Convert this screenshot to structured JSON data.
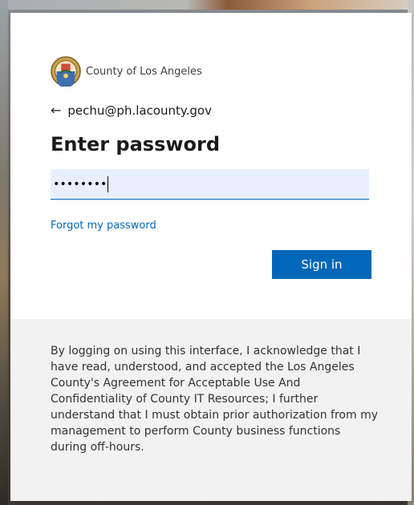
{
  "organization": {
    "name": "County of Los Angeles",
    "logo_icon": "county-seal-icon"
  },
  "identity": {
    "email": "pechu@ph.lacounty.gov",
    "back_icon": "arrow-left-icon"
  },
  "page": {
    "title": "Enter password"
  },
  "password": {
    "masked_value": "••••••••"
  },
  "links": {
    "forgot_password": "Forgot my password"
  },
  "buttons": {
    "sign_in": "Sign in"
  },
  "footer": {
    "text": "By logging on using this interface, I acknowledge that I have read, understood, and accepted the Los Angeles County's Agreement for Acceptable Use And Confidentiality of County IT Resources; I further understand that I must obtain prior authorization from my management to perform County business functions during off-hours."
  },
  "colors": {
    "accent": "#0067b8",
    "field_bg": "#e8f0fe",
    "footer_bg": "#f2f2f2",
    "card_bg": "#ffffff"
  }
}
